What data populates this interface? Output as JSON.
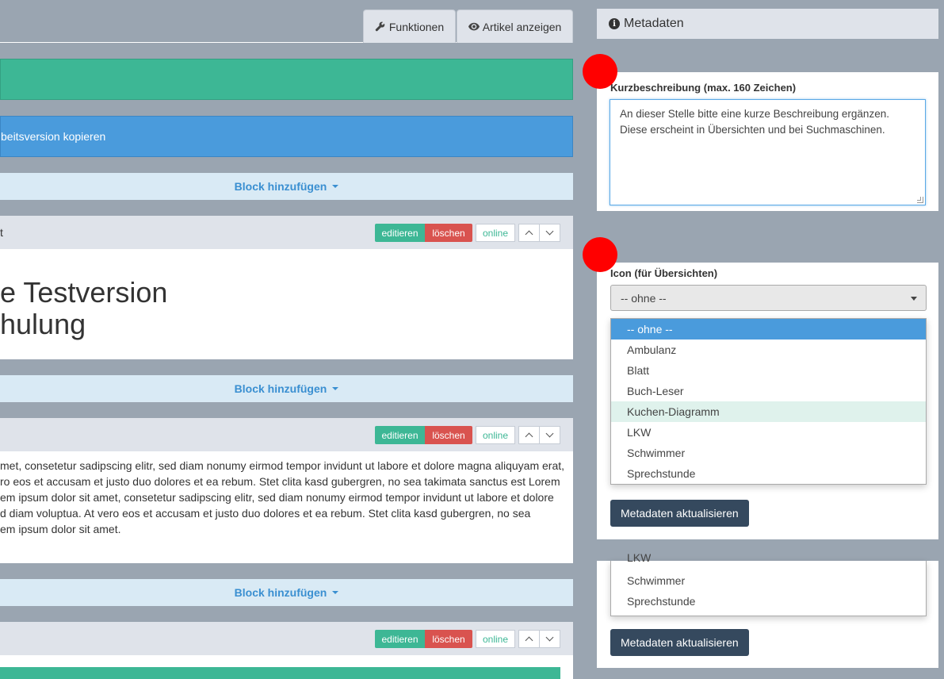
{
  "tabs": {
    "funktionen": "Funktionen",
    "artikel_anzeigen": "Artikel anzeigen"
  },
  "editor": {
    "copy_bar_text": "beitsversion kopieren",
    "add_block_label": "Block hinzufügen",
    "block1": {
      "title_fragment": "t",
      "heading_line1": "e Testversion",
      "heading_line2": "hulung"
    },
    "block2": {
      "text_lines": [
        "met, consetetur sadipscing elitr, sed diam nonumy eirmod tempor invidunt ut labore et dolore magna aliquyam erat,",
        "ro eos et accusam et justo duo dolores et ea rebum. Stet clita kasd gubergren, no sea takimata sanctus est Lorem",
        "em ipsum dolor sit amet, consetetur sadipscing elitr, sed diam nonumy eirmod tempor invidunt ut labore et dolore",
        "d diam voluptua. At vero eos et accusam et justo duo dolores et ea rebum. Stet clita kasd gubergren, no sea",
        "em ipsum dolor sit amet."
      ]
    },
    "buttons": {
      "edit": "editieren",
      "delete": "löschen",
      "online": "online"
    }
  },
  "metadata": {
    "tab_title": "Metadaten",
    "short_desc_label": "Kurzbeschreibung (max. 160 Zeichen)",
    "short_desc_value": "An dieser Stelle bitte eine kurze Beschreibung ergänzen. Diese erscheint in Übersichten und bei Suchmaschinen.",
    "icon_label": "Icon (für Übersichten)",
    "icon_selected": "-- ohne --",
    "icon_options": [
      "-- ohne --",
      "Ambulanz",
      "Blatt",
      "Buch-Leser",
      "Kuchen-Diagramm",
      "LKW",
      "Schwimmer",
      "Sprechstunde"
    ],
    "update_button": "Metadaten aktualisieren",
    "ghost_options": [
      "LKW",
      "Schwimmer",
      "Sprechstunde"
    ]
  },
  "colors": {
    "green": "#3db795",
    "blue": "#4a9bdc",
    "red": "#d9534f",
    "dark": "#35495e",
    "marker": "#ff0000"
  }
}
